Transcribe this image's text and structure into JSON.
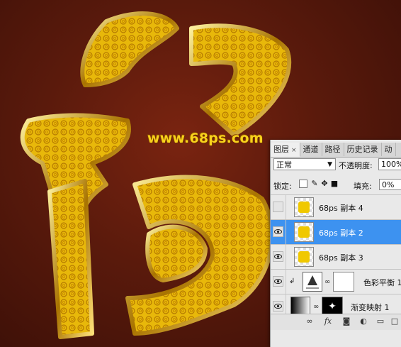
{
  "watermark": "www.68ps.com",
  "colors": {
    "gold": "#f0c800",
    "background": "#5a1a0c",
    "selected": "#3d92f0"
  },
  "panel": {
    "tabs": [
      {
        "label": "图层",
        "close": "×"
      },
      {
        "label": "通道"
      },
      {
        "label": "路径"
      },
      {
        "label": "历史记录"
      },
      {
        "label": "动"
      }
    ],
    "blend_mode": "正常",
    "opacity_label": "不透明度:",
    "opacity_value": "100%",
    "lock_label": "锁定:",
    "fill_label": "填充:",
    "fill_value": "0%",
    "layers": [
      {
        "name": "68ps 副本 4",
        "visible": false,
        "selected": false
      },
      {
        "name": "68ps 副本 2",
        "visible": true,
        "selected": true
      },
      {
        "name": "68ps 副本 3",
        "visible": true,
        "selected": false
      },
      {
        "name": "色彩平衡 1",
        "visible": true,
        "selected": false
      },
      {
        "name": "渐变映射 1",
        "visible": true,
        "selected": false
      }
    ],
    "bottom_icons": [
      "link-icon",
      "fx-icon",
      "mask-icon",
      "adjustment-icon",
      "folder-icon"
    ]
  }
}
